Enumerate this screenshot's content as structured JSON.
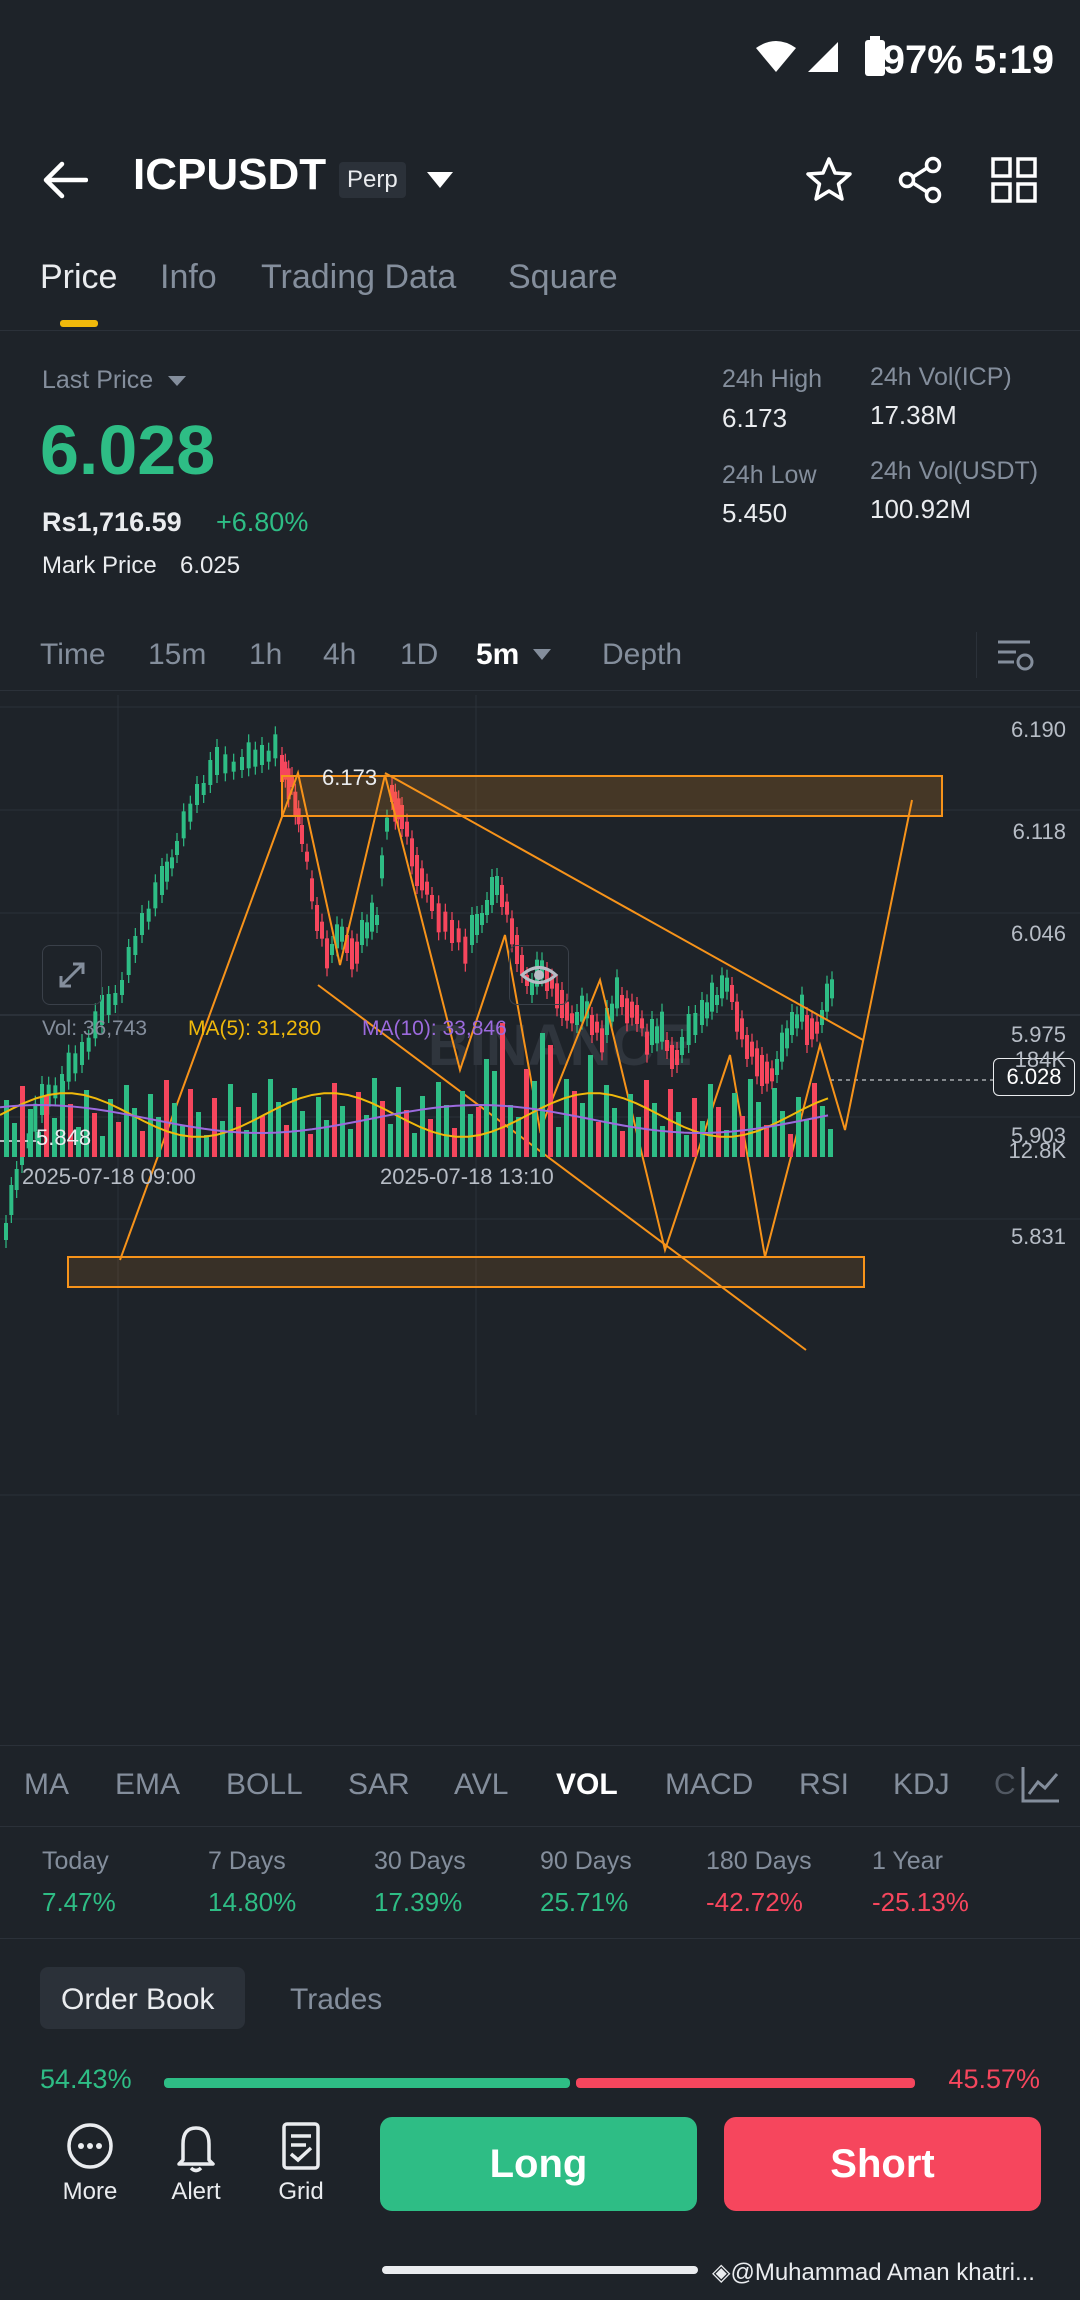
{
  "status_bar": {
    "battery": "97%",
    "time": "5:19"
  },
  "header": {
    "pair": "ICPUSDT",
    "contract_type": "Perp"
  },
  "tabs": [
    {
      "label": "Price",
      "active": true
    },
    {
      "label": "Info",
      "active": false
    },
    {
      "label": "Trading Data",
      "active": false
    },
    {
      "label": "Square",
      "active": false
    }
  ],
  "price": {
    "last_price_label": "Last Price",
    "last_price": "6.028",
    "local_price": "Rs1,716.59",
    "change_pct": "+6.80%",
    "mark_price_label": "Mark Price",
    "mark_price": "6.025"
  },
  "stats": {
    "high_label": "24h High",
    "high": "6.173",
    "low_label": "24h Low",
    "low": "5.450",
    "vol_icp_label": "24h Vol(ICP)",
    "vol_icp": "17.38M",
    "vol_usdt_label": "24h Vol(USDT)",
    "vol_usdt": "100.92M"
  },
  "intervals": [
    {
      "label": "Time"
    },
    {
      "label": "15m"
    },
    {
      "label": "1h"
    },
    {
      "label": "4h"
    },
    {
      "label": "1D"
    },
    {
      "label": "5m",
      "active": true
    },
    {
      "label": "Depth"
    }
  ],
  "chart": {
    "y_axis": [
      "6.190",
      "6.118",
      "6.046",
      "5.975",
      "5.903",
      "5.831"
    ],
    "current_price_tag": "6.028",
    "high_marker": "6.173",
    "low_marker": "5.848",
    "watermark": "BINANCE",
    "volume": {
      "vol_label": "Vol: 36,743",
      "ma5_label": "MA(5): 31,280",
      "ma10_label": "MA(10): 33,846",
      "y_top": "184K",
      "y_bottom": "12.8K"
    },
    "time_axis": [
      "2025-07-18 09:00",
      "2025-07-18 13:10"
    ]
  },
  "indicators": [
    {
      "label": "MA"
    },
    {
      "label": "EMA"
    },
    {
      "label": "BOLL"
    },
    {
      "label": "SAR"
    },
    {
      "label": "AVL"
    },
    {
      "label": "VOL",
      "active": true
    },
    {
      "label": "MACD"
    },
    {
      "label": "RSI"
    },
    {
      "label": "KDJ"
    },
    {
      "label": "C"
    }
  ],
  "performance": [
    {
      "label": "Today",
      "value": "7.47%",
      "positive": true
    },
    {
      "label": "7 Days",
      "value": "14.80%",
      "positive": true
    },
    {
      "label": "30 Days",
      "value": "17.39%",
      "positive": true
    },
    {
      "label": "90 Days",
      "value": "25.71%",
      "positive": true
    },
    {
      "label": "180 Days",
      "value": "-42.72%",
      "positive": false
    },
    {
      "label": "1 Year",
      "value": "-25.13%",
      "positive": false
    }
  ],
  "orderbook": {
    "tab_active": "Order Book",
    "tab_other": "Trades",
    "buy_pct": "54.43%",
    "sell_pct": "45.57%",
    "buy_ratio": 0.5443
  },
  "bottom_nav": {
    "more": "More",
    "alert": "Alert",
    "grid": "Grid",
    "long": "Long",
    "short": "Short"
  },
  "footer": {
    "watermark_text": "@Muhammad Aman khatri..."
  },
  "colors": {
    "bg": "#1e2329",
    "green": "#2ebd85",
    "red": "#f6465d",
    "accent": "#f0b90b",
    "drawing": "#f7931a"
  }
}
